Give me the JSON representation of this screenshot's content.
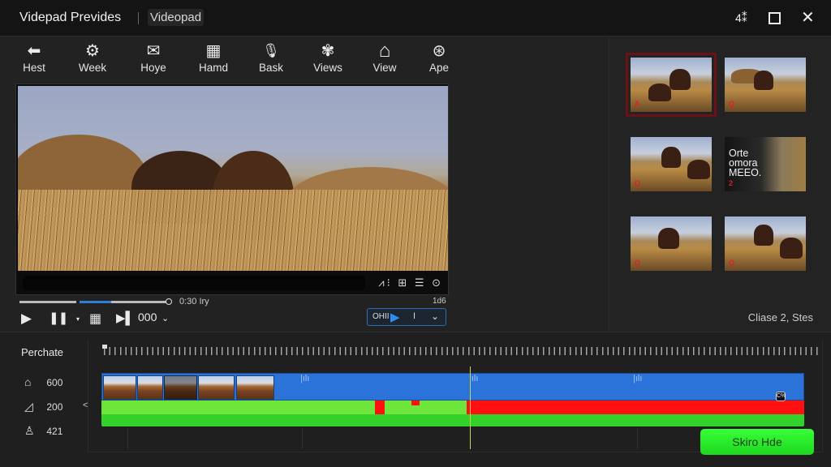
{
  "window": {
    "title": "Videpad Prevides",
    "tab": "Videopad",
    "controls": {
      "extra": "4⁑",
      "maximize": "",
      "close": "✕"
    }
  },
  "toolbar": {
    "items": [
      {
        "label": "Hest",
        "icon": "arrow-left-icon",
        "glyph": "⬅"
      },
      {
        "label": "Week",
        "icon": "gear-icon",
        "glyph": "⚙"
      },
      {
        "label": "Hoye",
        "icon": "mail-icon",
        "glyph": "✉"
      },
      {
        "label": "Hamd",
        "icon": "grid-board-icon",
        "glyph": "▦"
      },
      {
        "label": "Bask",
        "icon": "microphone-icon",
        "glyph": "🎙"
      },
      {
        "label": "Views",
        "icon": "aperture-icon",
        "glyph": "✾"
      },
      {
        "label": "View",
        "icon": "home-icon",
        "glyph": "⌂"
      },
      {
        "label": "Ape",
        "icon": "app-circle-icon",
        "glyph": "⊛"
      }
    ]
  },
  "viewer": {
    "controls_glyphs": "⩘⁝ ⊞ ☰ ⊙",
    "timecode": "0:30 Iry",
    "counter": "1d6",
    "scrub_progress": 0.35
  },
  "transport": {
    "play": "▶",
    "pause": "❚❚",
    "dropdown": "▾",
    "grid": "▦",
    "next": "▶▌",
    "speed": "000",
    "speed_chevron": "⌄"
  },
  "play_box": {
    "label": "OHII",
    "play": "▶",
    "value": "I",
    "chevron": "⌄"
  },
  "media_panel": {
    "thumbnails": [
      {
        "badge": "A",
        "selected": true,
        "text": ""
      },
      {
        "badge": "Q",
        "selected": false,
        "text": ""
      },
      {
        "badge": "Q",
        "selected": false,
        "text": ""
      },
      {
        "badge": "2",
        "selected": false,
        "text": "Orte\nomora\nMEEO."
      },
      {
        "badge": "Q",
        "selected": false,
        "text": ""
      },
      {
        "badge": "Q",
        "selected": false,
        "text": ""
      }
    ],
    "status": "Cliase 2, Stes"
  },
  "timeline": {
    "title": "Perchate",
    "rows": [
      {
        "icon": "house-icon",
        "glyph": "⌂",
        "value": "600"
      },
      {
        "icon": "chart-ramp-icon",
        "glyph": "◿",
        "value": "200"
      },
      {
        "icon": "person-icon",
        "glyph": "♙",
        "value": "421"
      }
    ],
    "collapse_arrow": "<",
    "marker_label": "C%",
    "clip_count": 5,
    "skip_button": "Skiro Hde",
    "colors": {
      "video_track": "#2c73d9",
      "audio_track": "#6de53a",
      "audio_muted": "#ff1111",
      "effects_track": "#34d12a",
      "skip_button": "#2ee82e",
      "accent_blue": "#2d8ef0"
    }
  }
}
